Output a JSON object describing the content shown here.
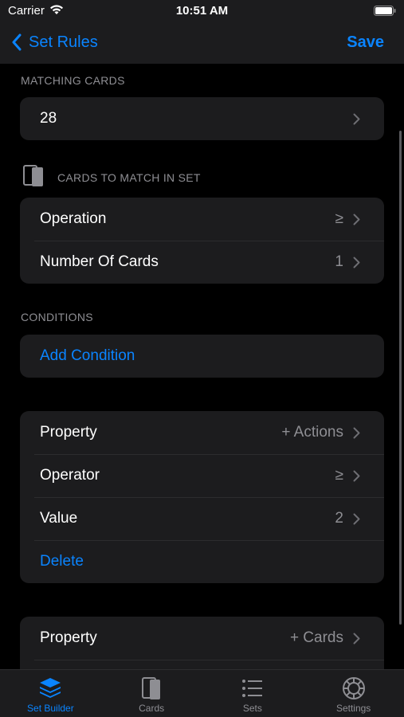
{
  "status": {
    "carrier": "Carrier",
    "time": "10:51 AM"
  },
  "nav": {
    "back_label": "Set Rules",
    "save_label": "Save"
  },
  "matching": {
    "header": "MATCHING CARDS",
    "count": "28"
  },
  "cards_to_match": {
    "header": "CARDS TO MATCH IN SET",
    "operation_label": "Operation",
    "operation_value": "≥",
    "number_label": "Number Of Cards",
    "number_value": "1"
  },
  "conditions": {
    "header": "CONDITIONS",
    "add_label": "Add Condition",
    "items": [
      {
        "property_label": "Property",
        "property_value": "+ Actions",
        "operator_label": "Operator",
        "operator_value": "≥",
        "value_label": "Value",
        "value_value": "2",
        "delete_label": "Delete"
      },
      {
        "property_label": "Property",
        "property_value": "+ Cards"
      }
    ]
  },
  "tabs": [
    {
      "label": "Set Builder",
      "icon": "stack-icon",
      "active": true
    },
    {
      "label": "Cards",
      "icon": "card-icon"
    },
    {
      "label": "Sets",
      "icon": "list-icon"
    },
    {
      "label": "Settings",
      "icon": "gear-icon"
    }
  ],
  "colors": {
    "accent": "#0a84ff",
    "background": "#000000",
    "group": "#1c1c1e",
    "secondary_text": "#8e8e93"
  }
}
